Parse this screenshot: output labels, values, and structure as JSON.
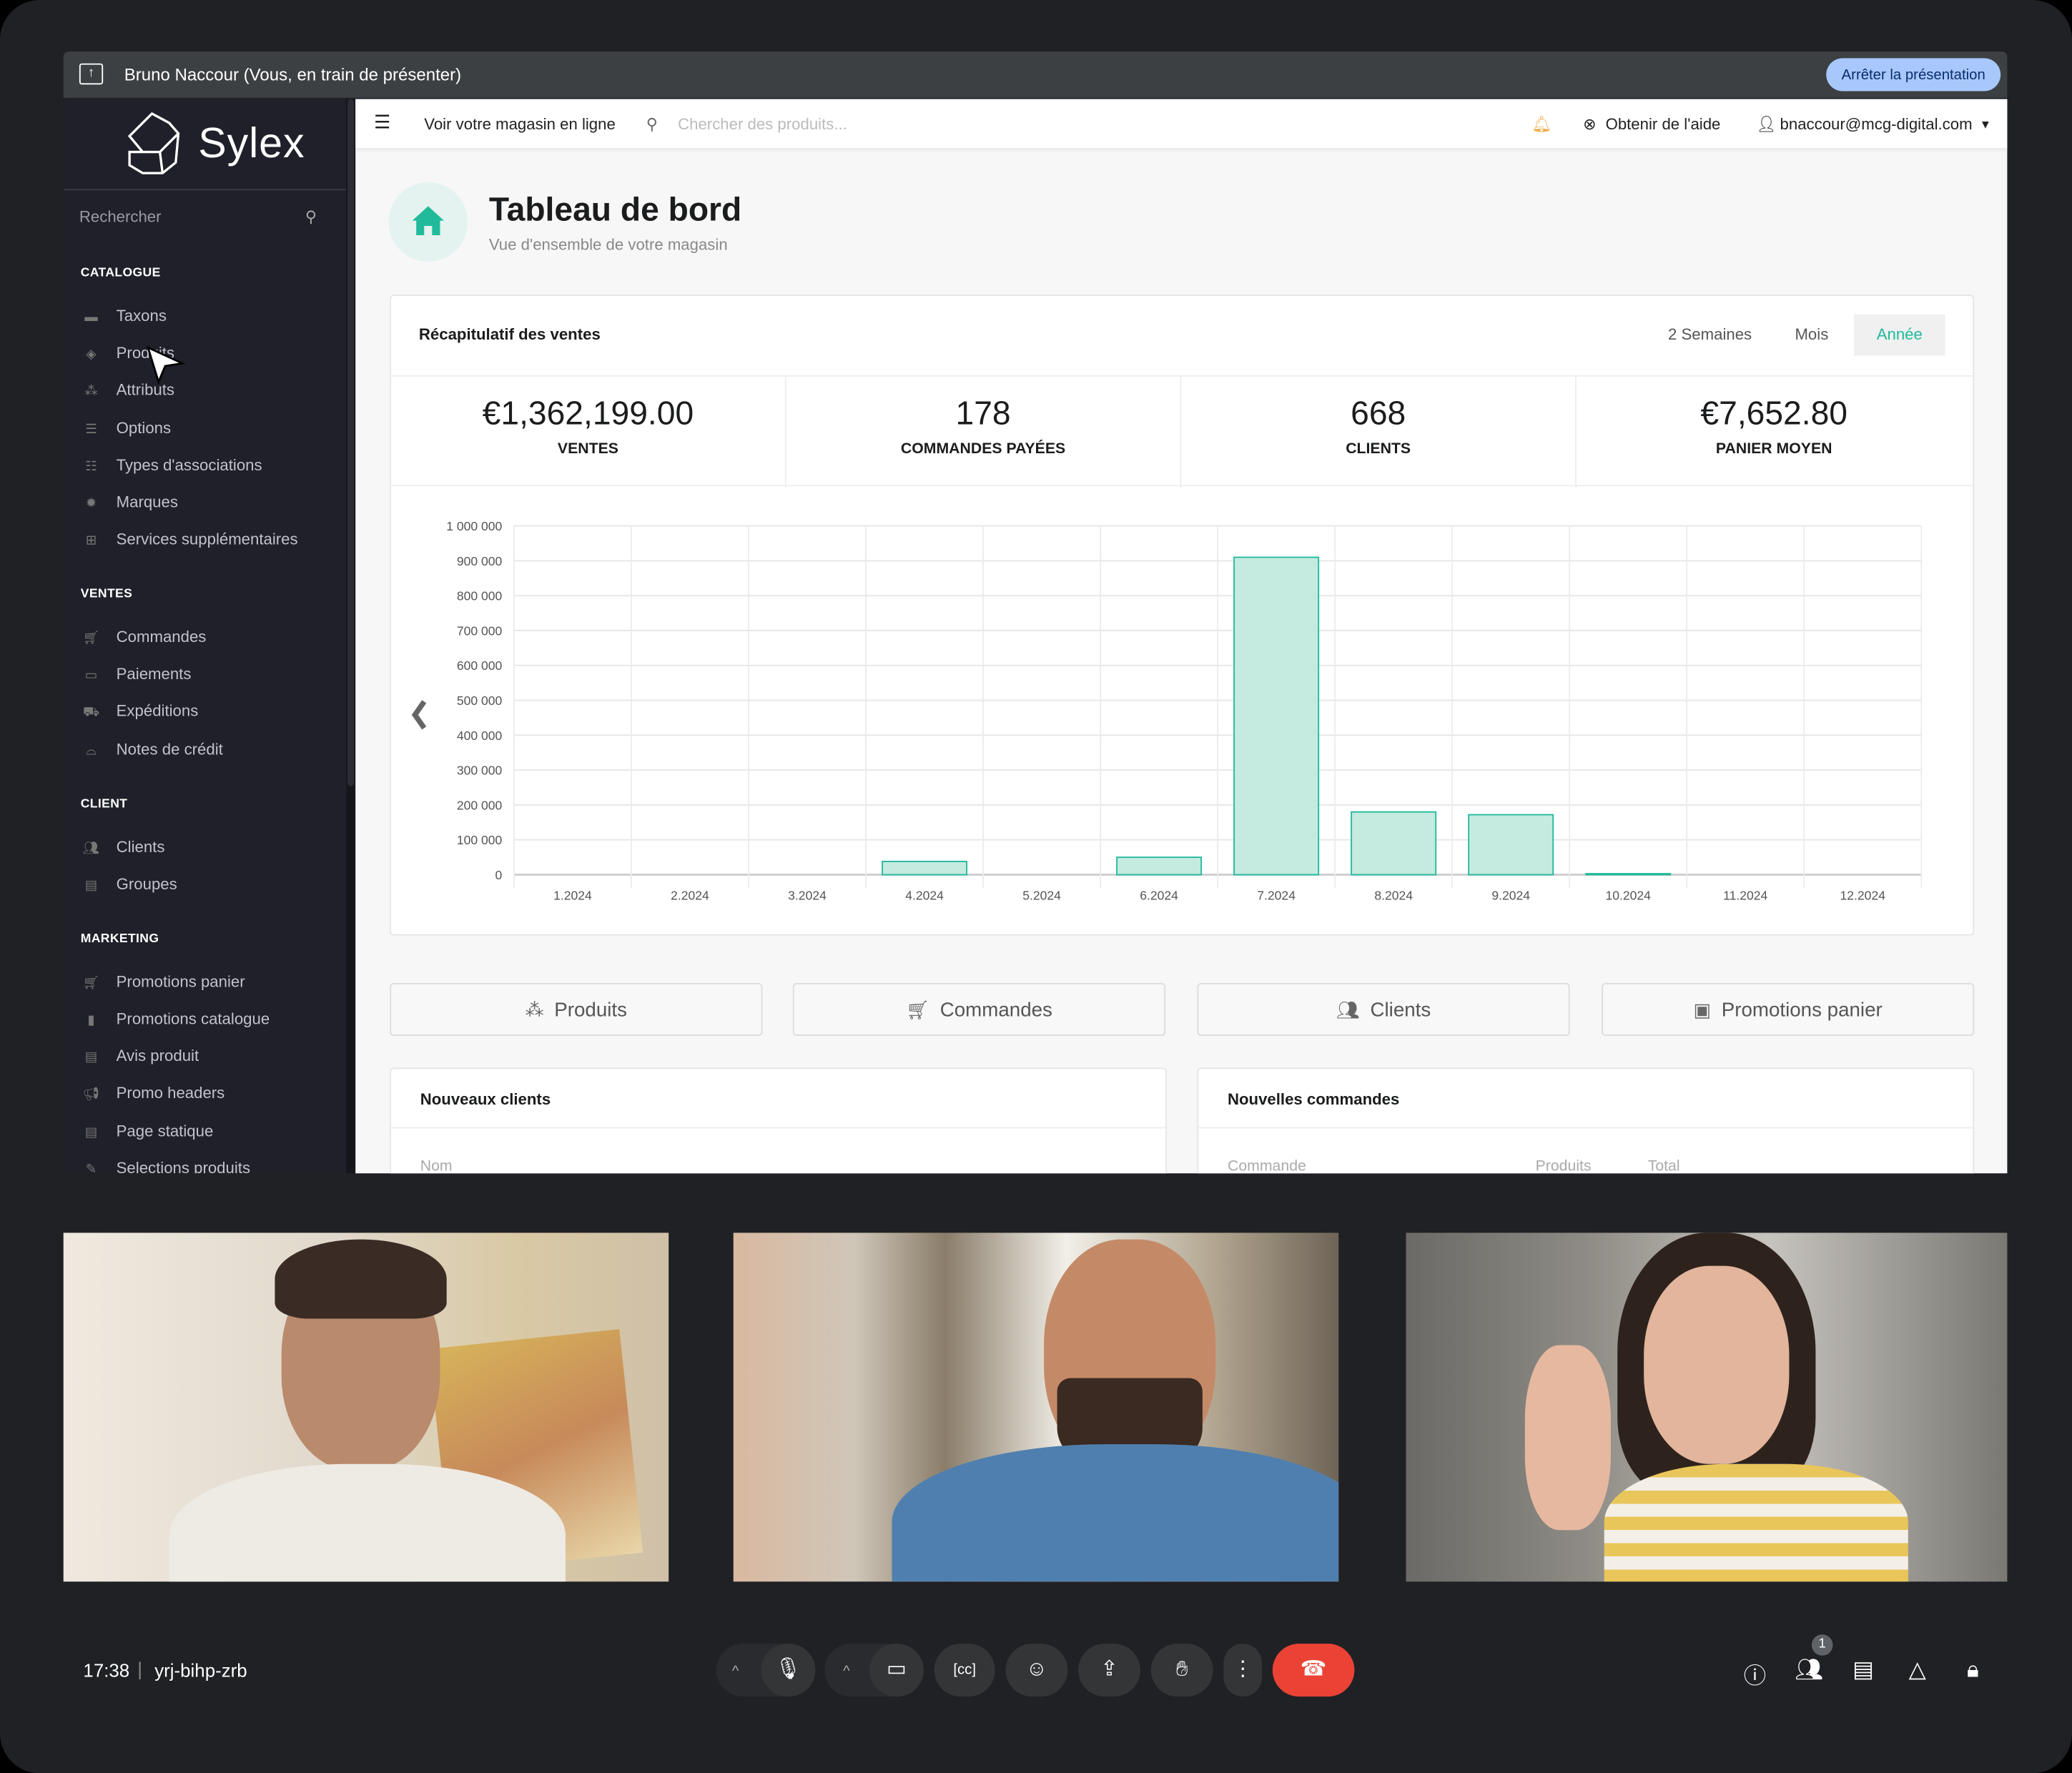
{
  "presenter": {
    "name": "Bruno Naccour (Vous, en train de présenter)",
    "stop_label": "Arrêter la présentation"
  },
  "app": {
    "brand": "Sylex"
  },
  "sidebar": {
    "search_label": "Rechercher",
    "sections": [
      {
        "title": "CATALOGUE",
        "items": [
          "Taxons",
          "Produits",
          "Attributs",
          "Options",
          "Types d'associations",
          "Marques",
          "Services supplémentaires"
        ]
      },
      {
        "title": "VENTES",
        "items": [
          "Commandes",
          "Paiements",
          "Expéditions",
          "Notes de crédit"
        ]
      },
      {
        "title": "CLIENT",
        "items": [
          "Clients",
          "Groupes"
        ]
      },
      {
        "title": "MARKETING",
        "items": [
          "Promotions panier",
          "Promotions catalogue",
          "Avis produit",
          "Promo headers",
          "Page statique",
          "Selections produits"
        ]
      }
    ]
  },
  "topbar": {
    "shop_link": "Voir votre magasin en ligne",
    "search_placeholder": "Chercher des produits...",
    "help": "Obtenir de l'aide",
    "user": "bnaccour@mcg-digital.com"
  },
  "page": {
    "title": "Tableau de bord",
    "subtitle": "Vue d'ensemble de votre magasin"
  },
  "sales": {
    "title": "Récapitulatif des ventes",
    "periods": [
      "2 Semaines",
      "Mois",
      "Année"
    ],
    "active_period": "Année",
    "stats": [
      {
        "value": "€1,362,199.00",
        "label": "VENTES"
      },
      {
        "value": "178",
        "label": "COMMANDES PAYÉES"
      },
      {
        "value": "668",
        "label": "CLIENTS"
      },
      {
        "value": "€7,652.80",
        "label": "PANIER MOYEN"
      }
    ]
  },
  "chart_data": {
    "type": "bar",
    "categories": [
      "1.2024",
      "2.2024",
      "3.2024",
      "4.2024",
      "5.2024",
      "6.2024",
      "7.2024",
      "8.2024",
      "9.2024",
      "10.2024",
      "11.2024",
      "12.2024"
    ],
    "values": [
      0,
      0,
      0,
      38000,
      0,
      50000,
      910000,
      180000,
      172000,
      3000,
      0,
      0
    ],
    "ylim": [
      0,
      1000000
    ],
    "yticks": [
      "0",
      "100 000",
      "200 000",
      "300 000",
      "400 000",
      "500 000",
      "600 000",
      "700 000",
      "800 000",
      "900 000",
      "1 000 000"
    ],
    "grid": true,
    "color": "#21ba9b"
  },
  "quick_links": [
    {
      "label": "Produits",
      "icon": "cubes-icon"
    },
    {
      "label": "Commandes",
      "icon": "cart-icon"
    },
    {
      "label": "Clients",
      "icon": "users-icon"
    },
    {
      "label": "Promotions panier",
      "icon": "promotion-icon"
    }
  ],
  "panels": {
    "new_customers": {
      "title": "Nouveaux clients",
      "columns": [
        "Nom"
      ]
    },
    "new_orders": {
      "title": "Nouvelles commandes",
      "columns": [
        "Commande",
        "Produits",
        "Total"
      ]
    }
  },
  "meeting": {
    "time": "17:38",
    "code": "yrj-bihp-zrb",
    "participants_badge": "1",
    "end_call_color": "#ea4335"
  }
}
